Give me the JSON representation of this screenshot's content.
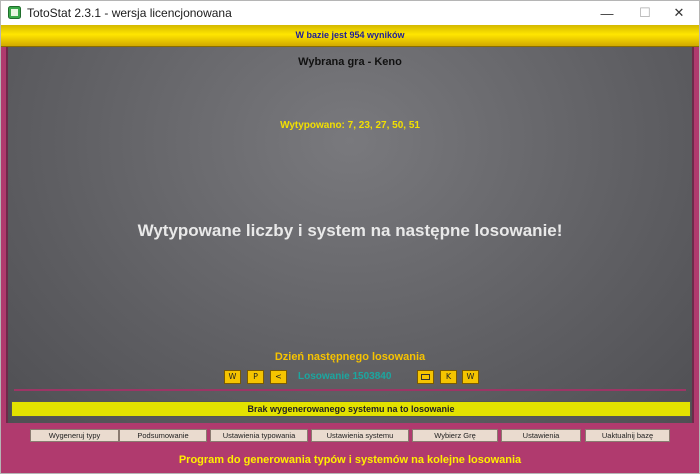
{
  "window": {
    "title": "TotoStat 2.3.1 - wersja licencjonowana",
    "controls": {
      "minimize": "—",
      "maximize": "☐",
      "close": "✕"
    }
  },
  "topbar": {
    "text": "W bazie jest 954 wyników"
  },
  "main": {
    "game_title": "Wybrana gra - Keno",
    "picked": "Wytypowano: 7, 23, 27, 50, 51",
    "heading": "Wytypowane liczby i system na następne losowanie!",
    "next_draw_label": "Dzień następnego losowania",
    "nav": {
      "left_buttons": [
        "W",
        "P",
        "<"
      ],
      "draw_text": "Losowanie 1503840",
      "right_buttons": [
        "K",
        "W"
      ]
    }
  },
  "status": {
    "text": "Brak wygenerowanego systemu na to losowanie"
  },
  "buttons": [
    "Wygeneruj typy",
    "Podsumowanie",
    "Ustawienia typowania",
    "Ustawienia systemu",
    "Wybierz Grę",
    "Ustawienia",
    "Uaktualnij bazę"
  ],
  "footer": {
    "text": "Program do generowania typów i systemów na kolejne losowania"
  },
  "colors": {
    "accent": "#b03a6e",
    "yellow": "#f5c400",
    "status_bg": "#e3e200",
    "draw_text": "#1ba7a0"
  }
}
